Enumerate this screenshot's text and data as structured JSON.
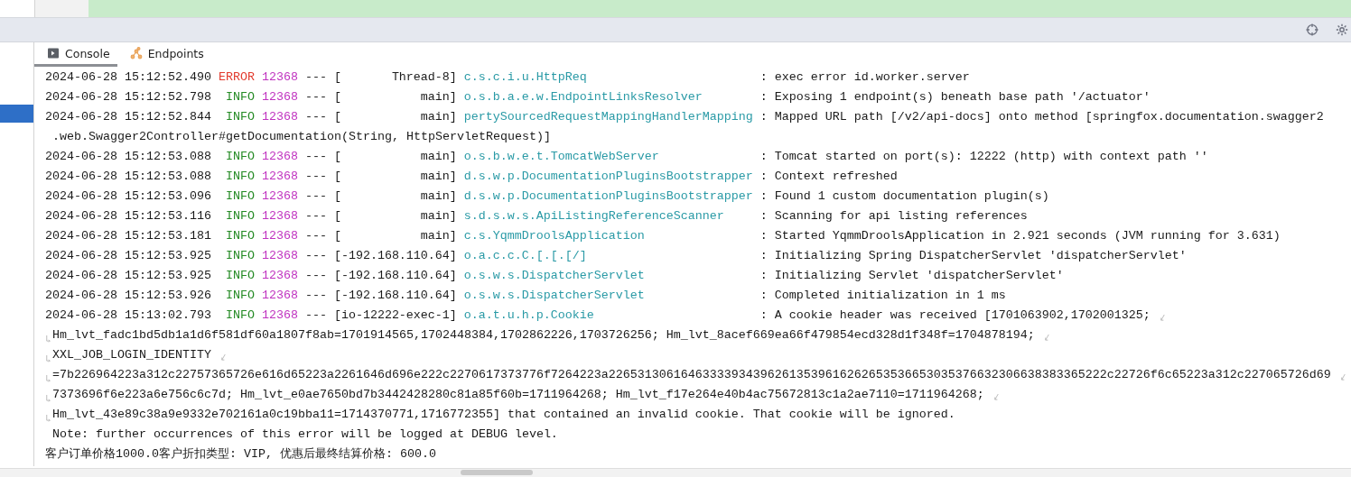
{
  "tabs": [
    {
      "label": "Console",
      "selected": true
    },
    {
      "label": "Endpoints",
      "selected": false
    }
  ],
  "log_lines": [
    {
      "kind": "log",
      "timestamp": "2024-06-28 15:12:52.490",
      "level": "ERROR",
      "pid": "12368",
      "separator": "---",
      "thread": "[       Thread-8]",
      "logger": "c.s.c.i.u.HttpReq",
      "message": ": exec error id.worker.server",
      "wrap_end": false
    },
    {
      "kind": "log",
      "timestamp": "2024-06-28 15:12:52.798",
      "level": "INFO",
      "pid": "12368",
      "separator": "---",
      "thread": "[           main]",
      "logger": "o.s.b.a.e.w.EndpointLinksResolver",
      "message": ": Exposing 1 endpoint(s) beneath base path '/actuator'",
      "wrap_end": false
    },
    {
      "kind": "log",
      "timestamp": "2024-06-28 15:12:52.844",
      "level": "INFO",
      "pid": "12368",
      "separator": "---",
      "thread": "[           main]",
      "logger": "pertySourcedRequestMappingHandlerMapping",
      "message": ": Mapped URL path [/v2/api-docs] onto method [springfox.documentation.swagger2",
      "wrap_end": false
    },
    {
      "kind": "continuation",
      "text": ".web.Swagger2Controller#getDocumentation(String, HttpServletRequest)]",
      "wrap_start": false,
      "wrap_end": false
    },
    {
      "kind": "log",
      "timestamp": "2024-06-28 15:12:53.088",
      "level": "INFO",
      "pid": "12368",
      "separator": "---",
      "thread": "[           main]",
      "logger": "o.s.b.w.e.t.TomcatWebServer",
      "message": ": Tomcat started on port(s): 12222 (http) with context path ''",
      "wrap_end": false
    },
    {
      "kind": "log",
      "timestamp": "2024-06-28 15:12:53.088",
      "level": "INFO",
      "pid": "12368",
      "separator": "---",
      "thread": "[           main]",
      "logger": "d.s.w.p.DocumentationPluginsBootstrapper",
      "message": ": Context refreshed",
      "wrap_end": false
    },
    {
      "kind": "log",
      "timestamp": "2024-06-28 15:12:53.096",
      "level": "INFO",
      "pid": "12368",
      "separator": "---",
      "thread": "[           main]",
      "logger": "d.s.w.p.DocumentationPluginsBootstrapper",
      "message": ": Found 1 custom documentation plugin(s)",
      "wrap_end": false
    },
    {
      "kind": "log",
      "timestamp": "2024-06-28 15:12:53.116",
      "level": "INFO",
      "pid": "12368",
      "separator": "---",
      "thread": "[           main]",
      "logger": "s.d.s.w.s.ApiListingReferenceScanner",
      "message": ": Scanning for api listing references",
      "wrap_end": false
    },
    {
      "kind": "log",
      "timestamp": "2024-06-28 15:12:53.181",
      "level": "INFO",
      "pid": "12368",
      "separator": "---",
      "thread": "[           main]",
      "logger": "c.s.YqmmDroolsApplication",
      "message": ": Started YqmmDroolsApplication in 2.921 seconds (JVM running for 3.631)",
      "wrap_end": false
    },
    {
      "kind": "log",
      "timestamp": "2024-06-28 15:12:53.925",
      "level": "INFO",
      "pid": "12368",
      "separator": "---",
      "thread": "[-192.168.110.64]",
      "logger": "o.a.c.c.C.[.[.[/]",
      "message": ": Initializing Spring DispatcherServlet 'dispatcherServlet'",
      "wrap_end": false
    },
    {
      "kind": "log",
      "timestamp": "2024-06-28 15:12:53.925",
      "level": "INFO",
      "pid": "12368",
      "separator": "---",
      "thread": "[-192.168.110.64]",
      "logger": "o.s.w.s.DispatcherServlet",
      "message": ": Initializing Servlet 'dispatcherServlet'",
      "wrap_end": false
    },
    {
      "kind": "log",
      "timestamp": "2024-06-28 15:12:53.926",
      "level": "INFO",
      "pid": "12368",
      "separator": "---",
      "thread": "[-192.168.110.64]",
      "logger": "o.s.w.s.DispatcherServlet",
      "message": ": Completed initialization in 1 ms",
      "wrap_end": false
    },
    {
      "kind": "log",
      "timestamp": "2024-06-28 15:13:02.793",
      "level": "INFO",
      "pid": "12368",
      "separator": "---",
      "thread": "[io-12222-exec-1]",
      "logger": "o.a.t.u.h.p.Cookie",
      "message": ": A cookie header was received [1701063902,1702001325;",
      "wrap_end": true
    },
    {
      "kind": "continuation",
      "text": "Hm_lvt_fadc1bd5db1a1d6f581df60a1807f8ab=1701914565,1702448384,1702862226,1703726256; Hm_lvt_8acef669ea66f479854ecd328d1f348f=1704878194;",
      "wrap_start": true,
      "wrap_end": true
    },
    {
      "kind": "continuation",
      "text": "XXL_JOB_LOGIN_IDENTITY",
      "wrap_start": true,
      "wrap_end": true
    },
    {
      "kind": "continuation",
      "text": "=7b226964223a312c22757365726e616d65223a2261646d696e222c2270617373776f7264223a226531306164633339343962613539616262653536653035376632306638383365222c22726f6c65223a312c227065726d69",
      "wrap_start": true,
      "wrap_end": true
    },
    {
      "kind": "continuation",
      "text": "7373696f6e223a6e756c6c7d; Hm_lvt_e0ae7650bd7b3442428280c81a85f60b=1711964268; Hm_lvt_f17e264e40b4ac75672813c1a2ae7110=1711964268;",
      "wrap_start": true,
      "wrap_end": true
    },
    {
      "kind": "continuation",
      "text": "Hm_lvt_43e89c38a9e9332e702161a0c19bba11=1714370771,1716772355] that contained an invalid cookie. That cookie will be ignored.",
      "wrap_start": true,
      "wrap_end": false
    },
    {
      "kind": "continuation",
      "text": "Note: further occurrences of this error will be logged at DEBUG level.",
      "wrap_start": false,
      "wrap_end": false
    },
    {
      "kind": "plain",
      "text": "客户订单价格1000.0客户折扣类型: VIP, 优惠后最终结算价格: 600.0"
    }
  ]
}
